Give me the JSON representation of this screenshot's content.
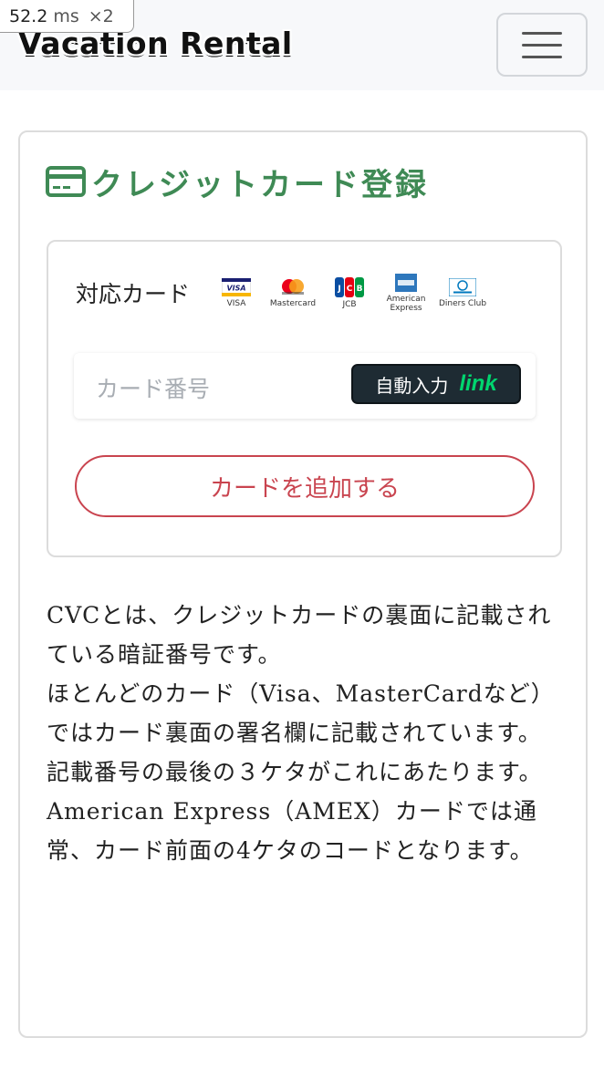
{
  "perf": {
    "value": "52.2",
    "unit": "ms",
    "multiplier": "×2"
  },
  "navbar": {
    "brand": "Vacation Rental"
  },
  "card": {
    "title": "クレジットカード登録",
    "supported_label": "対応カード",
    "brands": [
      {
        "name": "VISA",
        "caption": "VISA"
      },
      {
        "name": "Mastercard",
        "caption": "Mastercard"
      },
      {
        "name": "JCB",
        "caption": "JCB"
      },
      {
        "name": "American Express",
        "caption": "American Express"
      },
      {
        "name": "Diners Club",
        "caption": "Diners Club"
      }
    ],
    "card_number_placeholder": "カード番号",
    "autofill_label": "自動入力",
    "autofill_brand": "link",
    "add_button": "カードを追加する"
  },
  "cvc_info": {
    "paragraphs": [
      "CVCとは、クレジットカードの裏面に記載されている暗証番号です。",
      "ほとんどのカード（Visa、MasterCardなど）ではカード裏面の署名欄に記載されています。",
      "記載番号の最後の３ケタがこれにあたります。",
      "American Express（AMEX）カードでは通常、カード前面の4ケタのコードとなります。"
    ]
  },
  "colors": {
    "title_green": "#3f8a55",
    "danger_red": "#c9444f",
    "link_bg": "#1e2b33",
    "link_green": "#00d66f"
  }
}
